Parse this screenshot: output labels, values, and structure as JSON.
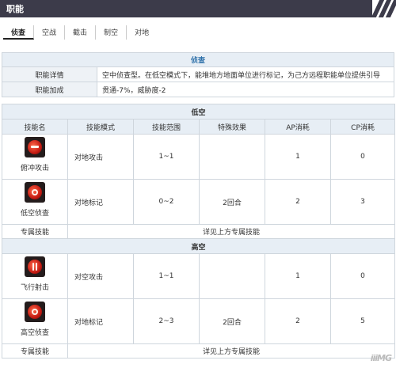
{
  "header": {
    "title": "职能"
  },
  "tabs": [
    {
      "label": "侦查",
      "active": true
    },
    {
      "label": "空战"
    },
    {
      "label": "截击"
    },
    {
      "label": "制空"
    },
    {
      "label": "对地"
    }
  ],
  "role": {
    "name": "侦查",
    "detail_label": "职能详情",
    "detail_value": "空中侦查型。在低空模式下，能堆地方地面单位进行标记，为己方远程职能单位提供引导",
    "bonus_label": "职能加成",
    "bonus_value": "贯通-7%，威胁度-2"
  },
  "columns": [
    "技能名",
    "技能模式",
    "技能范围",
    "特殊效果",
    "AP消耗",
    "CP消耗"
  ],
  "low": {
    "section": "低空",
    "rows": [
      {
        "name": "俯冲攻击",
        "icon": "dive-attack-icon",
        "mode": "对地攻击",
        "range": "1~1",
        "effect": "",
        "ap": "1",
        "cp": "0"
      },
      {
        "name": "低空侦查",
        "icon": "low-recon-icon",
        "mode": "对地标记",
        "range": "0~2",
        "effect": "2回合",
        "ap": "2",
        "cp": "3"
      }
    ],
    "exclusive_label": "专属技能",
    "exclusive_value": "详见上方专属技能"
  },
  "high": {
    "section": "高空",
    "rows": [
      {
        "name": "飞行射击",
        "icon": "flight-shot-icon",
        "mode": "对空攻击",
        "range": "1~1",
        "effect": "",
        "ap": "1",
        "cp": "0"
      },
      {
        "name": "高空侦查",
        "icon": "high-recon-icon",
        "mode": "对地标记",
        "range": "2~3",
        "effect": "2回合",
        "ap": "2",
        "cp": "5"
      }
    ],
    "exclusive_label": "专属技能",
    "exclusive_value": "详见上方专属技能"
  },
  "watermark": "iiiMG"
}
